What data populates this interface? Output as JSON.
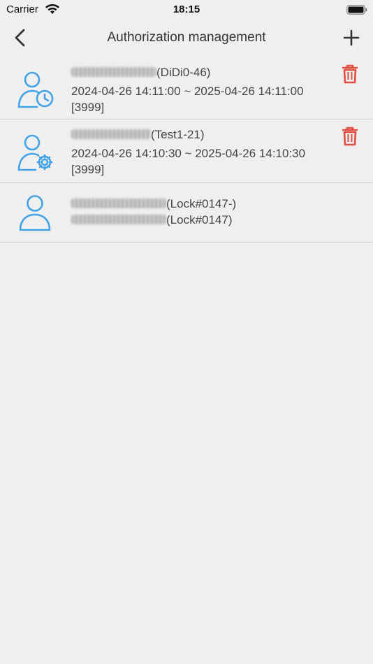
{
  "status_bar": {
    "carrier": "Carrier",
    "time": "18:15"
  },
  "nav": {
    "title": "Authorization management",
    "back_icon": "chevron-left-icon",
    "add_icon": "plus-icon"
  },
  "colors": {
    "accent_blue": "#43a3e6",
    "delete_red": "#e04e3f",
    "background": "#efefef"
  },
  "authorizations": [
    {
      "name": "(DiDi0-46)",
      "period": "2024-04-26 14:11:00 ~ 2025-04-26 14:11:00",
      "code": "[3999]",
      "icon": "user-clock-icon",
      "deletable": true
    },
    {
      "name": "(Test1-21)",
      "period": "2024-04-26 14:10:30 ~ 2025-04-26 14:10:30",
      "code": "[3999]",
      "icon": "user-gear-icon",
      "deletable": true
    },
    {
      "line1": "(Lock#0147-)",
      "line2": "(Lock#0147)",
      "icon": "user-icon",
      "deletable": false
    }
  ]
}
